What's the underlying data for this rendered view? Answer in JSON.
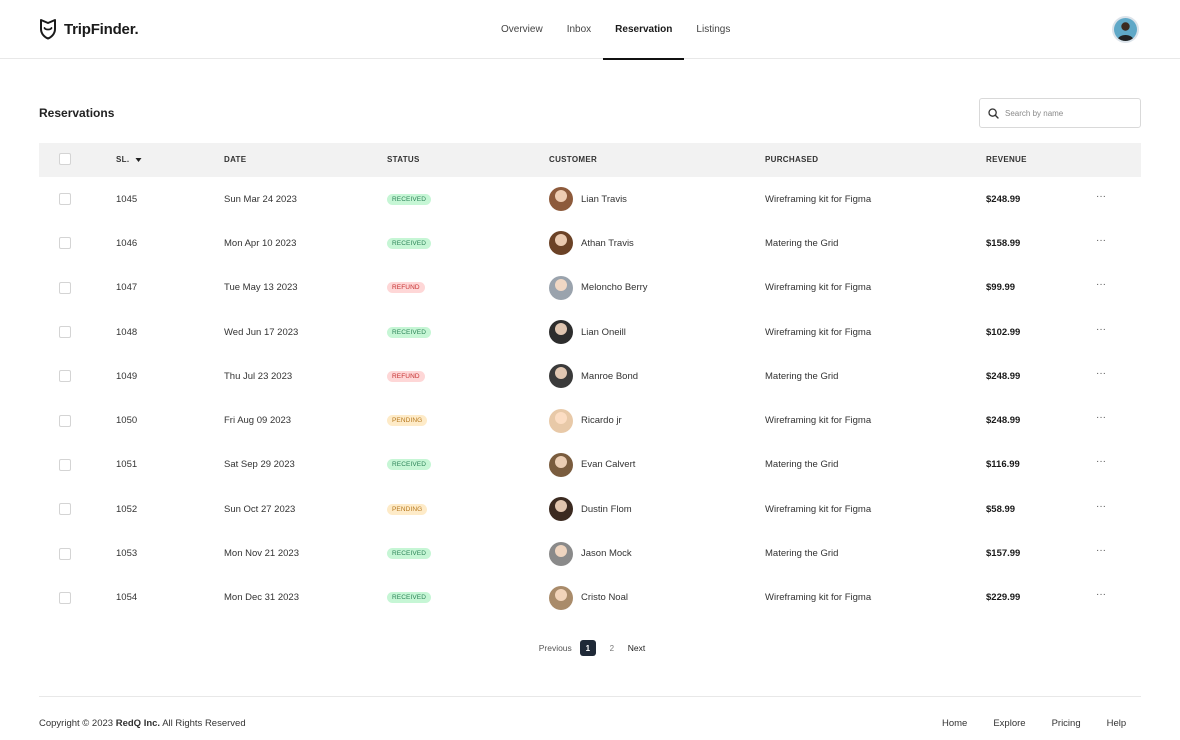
{
  "brand": {
    "name": "TripFinder."
  },
  "nav": [
    {
      "label": "Overview",
      "active": false
    },
    {
      "label": "Inbox",
      "active": false
    },
    {
      "label": "Reservation",
      "active": true
    },
    {
      "label": "Listings",
      "active": false
    }
  ],
  "page": {
    "title": "Reservations"
  },
  "search": {
    "placeholder": "Search by name"
  },
  "table": {
    "columns": {
      "sl": "SL.",
      "date": "DATE",
      "status": "STATUS",
      "customer": "CUSTOMER",
      "purchased": "PURCHASED",
      "revenue": "REVENUE"
    },
    "rows": [
      {
        "sl": "1045",
        "date": "Sun Mar 24 2023",
        "status": "RECEIVED",
        "status_key": "received",
        "customer": "Lian Travis",
        "avatar_color": "#8d5a3b",
        "purchased": "Wireframing kit for Figma",
        "revenue": "$248.99",
        "more": "···"
      },
      {
        "sl": "1046",
        "date": "Mon Apr 10 2023",
        "status": "RECEIVED",
        "status_key": "received",
        "customer": "Athan Travis",
        "avatar_color": "#6b4226",
        "purchased": "Matering the Grid",
        "revenue": "$158.99",
        "more": "···"
      },
      {
        "sl": "1047",
        "date": "Tue May 13 2023",
        "status": "REFUND",
        "status_key": "refund",
        "customer": "Meloncho Berry",
        "avatar_color": "#9aa3ad",
        "purchased": "Wireframing kit for Figma",
        "revenue": "$99.99",
        "more": "···"
      },
      {
        "sl": "1048",
        "date": "Wed Jun 17 2023",
        "status": "RECEIVED",
        "status_key": "received",
        "customer": "Lian Oneill",
        "avatar_color": "#2d2d2d",
        "purchased": "Wireframing kit for Figma",
        "revenue": "$102.99",
        "more": "···"
      },
      {
        "sl": "1049",
        "date": "Thu Jul 23 2023",
        "status": "REFUND",
        "status_key": "refund",
        "customer": "Manroe Bond",
        "avatar_color": "#3a3a3a",
        "purchased": "Matering the Grid",
        "revenue": "$248.99",
        "more": "···"
      },
      {
        "sl": "1050",
        "date": "Fri Aug 09 2023",
        "status": "PENDING",
        "status_key": "pending",
        "customer": "Ricardo jr",
        "avatar_color": "#e8c9a8",
        "purchased": "Wireframing kit for Figma",
        "revenue": "$248.99",
        "more": "···"
      },
      {
        "sl": "1051",
        "date": "Sat Sep 29 2023",
        "status": "RECEIVED",
        "status_key": "received",
        "customer": "Evan Calvert",
        "avatar_color": "#7a5c3e",
        "purchased": "Matering the Grid",
        "revenue": "$116.99",
        "more": "···"
      },
      {
        "sl": "1052",
        "date": "Sun Oct 27 2023",
        "status": "PENDING",
        "status_key": "pending",
        "customer": "Dustin Flom",
        "avatar_color": "#3b2a20",
        "purchased": "Wireframing kit for Figma",
        "revenue": "$58.99",
        "more": "···"
      },
      {
        "sl": "1053",
        "date": "Mon Nov 21 2023",
        "status": "RECEIVED",
        "status_key": "received",
        "customer": "Jason Mock",
        "avatar_color": "#8a8a8a",
        "purchased": "Matering the Grid",
        "revenue": "$157.99",
        "more": "···"
      },
      {
        "sl": "1054",
        "date": "Mon Dec 31 2023",
        "status": "RECEIVED",
        "status_key": "received",
        "customer": "Cristo Noal",
        "avatar_color": "#a98b6a",
        "purchased": "Wireframing kit for Figma",
        "revenue": "$229.99",
        "more": "···"
      }
    ]
  },
  "pagination": {
    "previous": "Previous",
    "pages": [
      "1",
      "2"
    ],
    "current": "1",
    "next": "Next"
  },
  "footer": {
    "copyright_prefix": "Copyright © 2023",
    "company": "RedQ Inc.",
    "copyright_suffix": "All Rights Reserved",
    "links": [
      "Home",
      "Explore",
      "Pricing",
      "Help"
    ]
  },
  "icons": {
    "logo": "shield-logo-icon",
    "search": "search-icon",
    "sort": "caret-down-icon",
    "more": "more-horizontal-icon"
  }
}
